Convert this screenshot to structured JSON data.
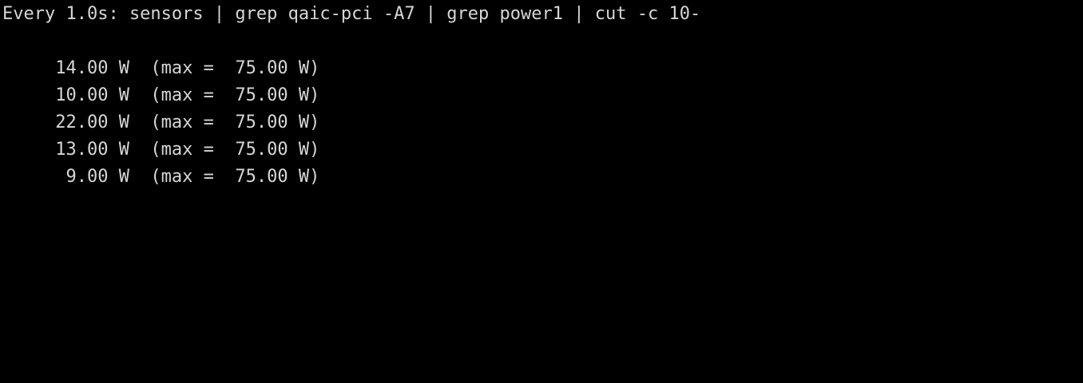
{
  "terminal": {
    "header": "Every 1.0s: sensors | grep qaic-pci -A7 | grep power1 | cut -c 10-",
    "lines": [
      "     14.00 W  (max =  75.00 W)",
      "     10.00 W  (max =  75.00 W)",
      "     22.00 W  (max =  75.00 W)",
      "     13.00 W  (max =  75.00 W)",
      "      9.00 W  (max =  75.00 W)"
    ]
  },
  "colors": {
    "background": "#000000",
    "text": "#d6d6d6"
  }
}
